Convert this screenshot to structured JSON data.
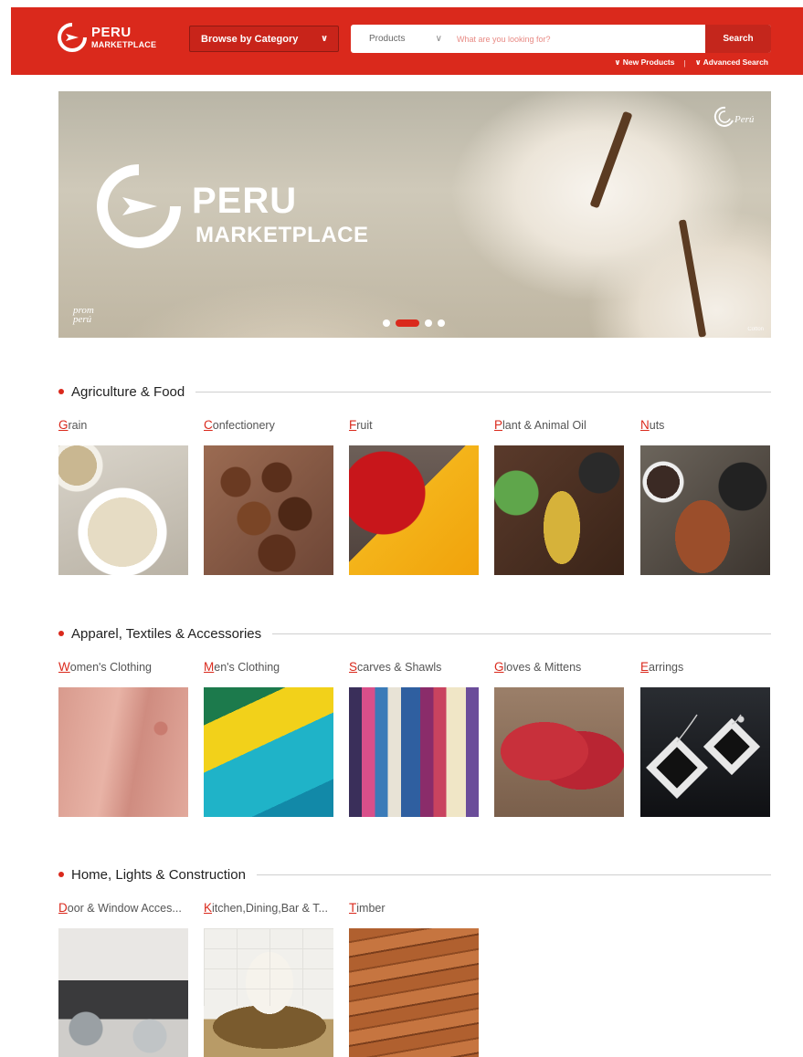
{
  "header": {
    "logo": {
      "line1": "PERU",
      "line2": "MARKETPLACE"
    },
    "browse_label": "Browse by Category",
    "search": {
      "scope": "Products",
      "placeholder": "What are you looking for?",
      "button": "Search"
    },
    "links": [
      "New Products",
      "Advanced Search"
    ]
  },
  "banner": {
    "logo_line1": "PERU",
    "logo_line2": "MARKETPLACE",
    "promperu": [
      "prom",
      "perú"
    ],
    "marca": "Perú",
    "credit": "Cotton",
    "slides": 4,
    "active_slide": 2
  },
  "sections": [
    {
      "title": "Agriculture & Food",
      "items": [
        {
          "initial": "G",
          "rest": "rain"
        },
        {
          "initial": "C",
          "rest": "onfectionery"
        },
        {
          "initial": "F",
          "rest": "ruit"
        },
        {
          "initial": "P",
          "rest": "lant & Animal Oil"
        },
        {
          "initial": "N",
          "rest": "uts"
        }
      ]
    },
    {
      "title": "Apparel, Textiles & Accessories",
      "items": [
        {
          "initial": "W",
          "rest": "omen's Clothing"
        },
        {
          "initial": "M",
          "rest": "en's Clothing"
        },
        {
          "initial": "S",
          "rest": "carves & Shawls"
        },
        {
          "initial": "G",
          "rest": "loves & Mittens"
        },
        {
          "initial": "E",
          "rest": "arrings"
        }
      ]
    },
    {
      "title": "Home, Lights & Construction",
      "items": [
        {
          "initial": "D",
          "rest": "oor & Window Acces..."
        },
        {
          "initial": "K",
          "rest": "itchen,Dining,Bar & T..."
        },
        {
          "initial": "T",
          "rest": "imber"
        }
      ]
    }
  ],
  "colors": {
    "brand_red": "#da291c",
    "text": "#555555"
  },
  "icons": [
    "peru-logo-icon",
    "chevron-down-icon",
    "search-scope-chevron-icon",
    "promperu-logo-icon",
    "marca-peru-icon"
  ]
}
